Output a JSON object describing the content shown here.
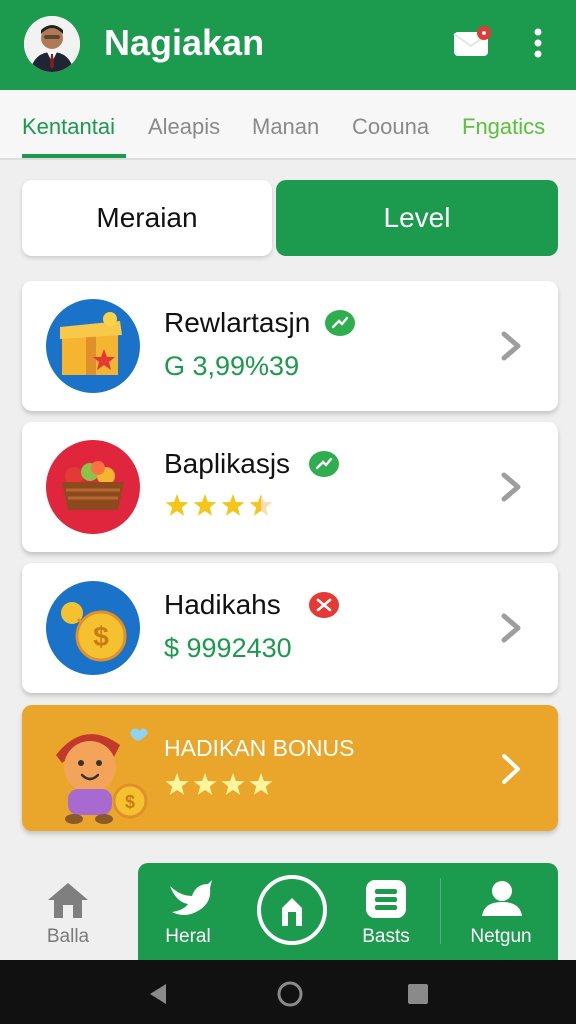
{
  "header": {
    "title": "Nagiakan",
    "mail_badge_color": "#e53935"
  },
  "tabs": [
    {
      "label": "Kentantai",
      "active": true
    },
    {
      "label": "Aleapis",
      "active": false
    },
    {
      "label": "Manan",
      "active": false
    },
    {
      "label": "Coouna",
      "active": false
    },
    {
      "label": "Fngatics",
      "active": false,
      "highlight": true
    }
  ],
  "segment": {
    "left_label": "Meraian",
    "right_label": "Level",
    "selected": "Level"
  },
  "cards": [
    {
      "title": "Rewlartasjn",
      "badge": "trend-up-green",
      "value": "G 3,99%39",
      "icon": "gift-box-icon"
    },
    {
      "title": "Baplikasjs",
      "badge": "trend-up-green",
      "rating": 3.5,
      "rating_max": 4,
      "icon": "fruit-basket-icon"
    },
    {
      "title": "Hadikahs",
      "badge": "down-red",
      "value": "$ 9992430",
      "icon": "dollar-coin-icon"
    }
  ],
  "bonus": {
    "title": "HADIKAN BONUS",
    "rating": 4,
    "rating_max": 4
  },
  "bottom_nav": [
    {
      "label": "Balla",
      "icon": "home-icon"
    },
    {
      "label": "Heral",
      "icon": "bird-icon"
    },
    {
      "label": "",
      "icon": "center-action-icon"
    },
    {
      "label": "Basts",
      "icon": "list-icon"
    },
    {
      "label": "Netgun",
      "icon": "user-icon"
    }
  ],
  "colors": {
    "brand_green": "#1c9a4d",
    "bonus_orange": "#e9a62a",
    "star_yellow": "#f5c518"
  }
}
